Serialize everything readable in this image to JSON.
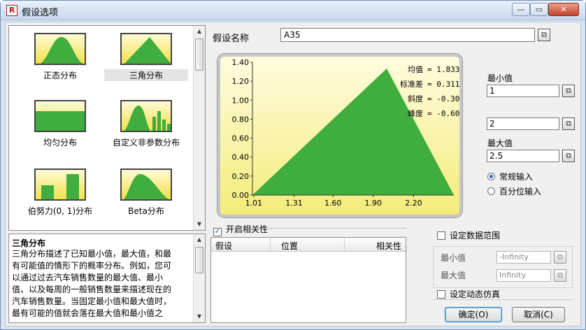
{
  "window": {
    "icon_letter": "R",
    "title": "假设选项",
    "min_glyph": "—",
    "max_glyph": "▭",
    "close_glyph": "✕"
  },
  "gallery": {
    "items": [
      {
        "label": "正态分布",
        "icon": "normal-distribution-icon"
      },
      {
        "label": "三角分布",
        "icon": "triangular-distribution-icon",
        "selected": true
      },
      {
        "label": "均匀分布",
        "icon": "uniform-distribution-icon"
      },
      {
        "label": "自定义非参数分布",
        "icon": "custom-nonparametric-distribution-icon"
      },
      {
        "label": "伯努力(0, 1)分布",
        "icon": "bernoulli-distribution-icon"
      },
      {
        "label": "Beta分布",
        "icon": "beta-distribution-icon"
      }
    ],
    "up_arrow": "▲",
    "down_arrow": "▼"
  },
  "description": {
    "title": "三角分布",
    "lines": [
      "三角分布描述了已知最小值，最大值，和最",
      "有可能值的情形下的概率分布。例如，您可",
      "以通过过去汽车销售数量的最大值、最小",
      "值、以及每周的一般销售数量来描述现在的",
      "汽车销售数量。当固定最小值和最大值时，",
      "最有可能的值就会落在最大值和最小值之"
    ]
  },
  "assumption": {
    "name_label": "假设名称",
    "name_value": "A35",
    "cellref_glyph": "⧉"
  },
  "chart_data": {
    "type": "area",
    "x": [
      1.0,
      2.0,
      2.5
    ],
    "y": [
      0.0,
      1.3333,
      0.0
    ],
    "xticks": [
      "1.01",
      "1.31",
      "1.60",
      "1.90",
      "2.20"
    ],
    "xtick_values": [
      1.01,
      1.31,
      1.6,
      1.9,
      2.2
    ],
    "yticks": [
      "0.00",
      "0.20",
      "0.40",
      "0.60",
      "0.80",
      "1.00",
      "1.20",
      "1.40"
    ],
    "ylim": [
      0,
      1.4
    ],
    "xlim": [
      1.0,
      2.5
    ],
    "fill_color": "#3fae3f",
    "stats": [
      {
        "label": "均值",
        "value": "= 1.8333"
      },
      {
        "label": "标准差",
        "value": "= 0.3118"
      },
      {
        "label": "斜度",
        "value": "= -0.3054"
      },
      {
        "label": "峰度",
        "value": "= -0.6000"
      }
    ]
  },
  "params": {
    "min_label": "最小值",
    "min_value": "1",
    "likely_value": "2",
    "max_label": "最大值",
    "max_value": "2.5",
    "radio_normal": "常规输入",
    "radio_percentile": "百分位输入"
  },
  "correlation": {
    "checkbox_label": "开启相关性",
    "checked_glyph": "✓",
    "columns": [
      "假设",
      "位置",
      "相关性"
    ]
  },
  "data_range": {
    "checkbox_label": "设定数据范围",
    "min_label": "最小值",
    "min_value": "-Infinity",
    "max_label": "最大值",
    "max_value": "Infinity"
  },
  "dynamic": {
    "checkbox_label": "设定动态仿真"
  },
  "buttons": {
    "ok": "确定(O)",
    "cancel": "取消(C)"
  }
}
